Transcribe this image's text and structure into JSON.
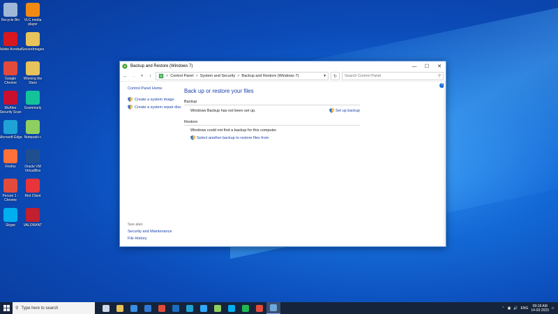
{
  "desktop": {
    "icons": [
      {
        "label": "Recycle Bin",
        "icon": "recycle-bin-icon",
        "color": "#9fb8d8"
      },
      {
        "label": "VLC media player",
        "icon": "vlc-icon",
        "color": "#f28a12"
      },
      {
        "label": "Adobe Acrobat",
        "icon": "acrobat-icon",
        "color": "#d8181f"
      },
      {
        "label": "SecureImages",
        "icon": "folder-icon",
        "color": "#e8c25a"
      },
      {
        "label": "Google Chrome",
        "icon": "chrome-icon",
        "color": "#e24b3b"
      },
      {
        "label": "Winning the Stars",
        "icon": "folder-icon",
        "color": "#e8c25a"
      },
      {
        "label": "McAfee Security Scan",
        "icon": "mcafee-icon",
        "color": "#c8102e"
      },
      {
        "label": "Grammarly",
        "icon": "grammarly-icon",
        "color": "#15c39a"
      },
      {
        "label": "Microsoft Edge",
        "icon": "edge-icon",
        "color": "#1fa3d6"
      },
      {
        "label": "Notepad++",
        "icon": "notepad-icon",
        "color": "#8fcf5f"
      },
      {
        "label": "Firefox",
        "icon": "firefox-icon",
        "color": "#ff7139"
      },
      {
        "label": "Oracle VM VirtualBox",
        "icon": "virtualbox-icon",
        "color": "#1f4f8f"
      },
      {
        "label": "Person 1 - Chrome",
        "icon": "chrome-icon",
        "color": "#e24b3b"
      },
      {
        "label": "Riot Client",
        "icon": "riot-icon",
        "color": "#e8343b"
      },
      {
        "label": "Skype",
        "icon": "skype-icon",
        "color": "#00aff0"
      },
      {
        "label": "VALORANT",
        "icon": "valorant-icon",
        "color": "#c21f2f"
      }
    ]
  },
  "window": {
    "title": "Backup and Restore (Windows 7)",
    "minimize": "—",
    "maximize": "☐",
    "close": "✕",
    "breadcrumb": [
      "Control Panel",
      "System and Security",
      "Backup and Restore (Windows 7)"
    ],
    "breadcrumb_sep": ">",
    "search_placeholder": "Search Control Panel",
    "help": "?",
    "sidebar": {
      "home": "Control Panel Home",
      "tasks": [
        "Create a system image",
        "Create a system repair disc"
      ]
    },
    "see_also": {
      "heading": "See also",
      "links": [
        "Security and Maintenance",
        "File History"
      ]
    },
    "main": {
      "heading": "Back up or restore your files",
      "backup_label": "Backup",
      "backup_status": "Windows Backup has not been set up.",
      "setup_link": "Set up backup",
      "restore_label": "Restore",
      "restore_status": "Windows could not find a backup for this computer.",
      "restore_link": "Select another backup to restore files from"
    }
  },
  "taskbar": {
    "search_placeholder": "Type here to search",
    "apps": [
      {
        "name": "task-view",
        "color": "#cfd8e6"
      },
      {
        "name": "file-explorer",
        "color": "#e8c25a"
      },
      {
        "name": "microsoft-store",
        "color": "#3a8ee6"
      },
      {
        "name": "mail",
        "color": "#2f7ad6"
      },
      {
        "name": "chrome",
        "color": "#e24b3b"
      },
      {
        "name": "outlook",
        "color": "#1b6ec2"
      },
      {
        "name": "edge",
        "color": "#1fa3d6"
      },
      {
        "name": "photoshop",
        "color": "#31a8ff"
      },
      {
        "name": "notepad-plus",
        "color": "#8fcf5f"
      },
      {
        "name": "skype",
        "color": "#00aff0"
      },
      {
        "name": "spotify",
        "color": "#1db954"
      },
      {
        "name": "chrome-profile",
        "color": "#e24b3b"
      },
      {
        "name": "control-panel",
        "color": "#6fa8dc"
      }
    ],
    "language": "ENG",
    "time": "09:18 AM",
    "date": "14-03-2023"
  },
  "colors": {
    "link": "#1a3fa8",
    "taskbar": "#16243b"
  }
}
